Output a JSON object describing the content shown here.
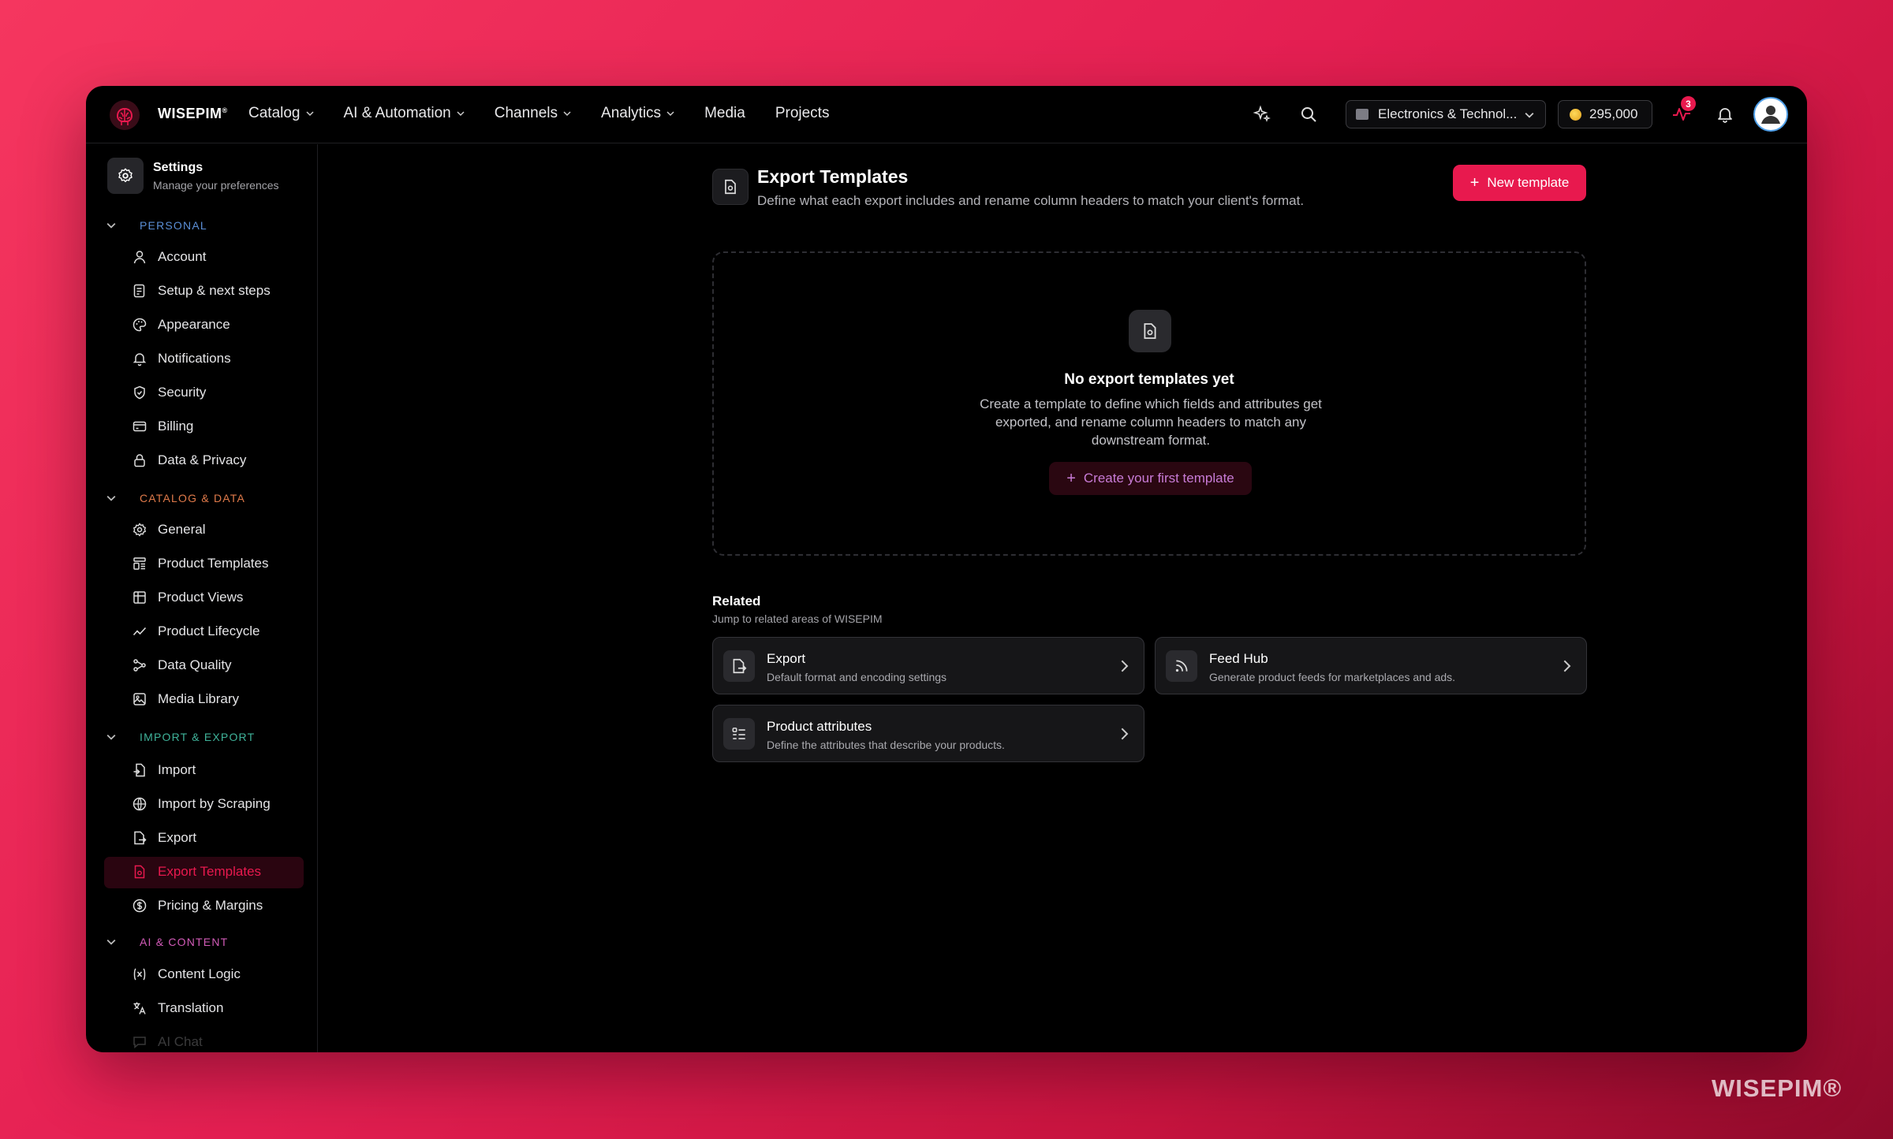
{
  "brand": "WISEPIM",
  "nav": {
    "catalog": "Catalog",
    "ai": "AI & Automation",
    "channels": "Channels",
    "analytics": "Analytics",
    "media": "Media",
    "projects": "Projects"
  },
  "store_select": "Electronics & Technol...",
  "credits": "295,000",
  "activity_badge": "3",
  "sidebar": {
    "title": "Settings",
    "subtitle": "Manage your preferences",
    "sections": {
      "personal": "PERSONAL",
      "catalog": "CATALOG & DATA",
      "import": "IMPORT & EXPORT",
      "ai": "AI & CONTENT"
    },
    "items": {
      "account": "Account",
      "setup": "Setup & next steps",
      "appearance": "Appearance",
      "notifications": "Notifications",
      "security": "Security",
      "billing": "Billing",
      "privacy": "Data & Privacy",
      "general": "General",
      "product_templates": "Product Templates",
      "product_views": "Product Views",
      "product_lifecycle": "Product Lifecycle",
      "data_quality": "Data Quality",
      "media_library": "Media Library",
      "import": "Import",
      "import_scraping": "Import by Scraping",
      "export": "Export",
      "export_templates": "Export Templates",
      "pricing": "Pricing & Margins",
      "content_logic": "Content Logic",
      "translation": "Translation",
      "ai_chat": "AI Chat"
    }
  },
  "page": {
    "title": "Export Templates",
    "subtitle": "Define what each export includes and rename column headers to match your client's format.",
    "new_button": "New template"
  },
  "empty": {
    "title": "No export templates yet",
    "description": "Create a template to define which fields and attributes get exported, and rename column headers to match any downstream format.",
    "button": "Create your first template"
  },
  "related": {
    "title": "Related",
    "subtitle": "Jump to related areas of WISEPIM",
    "cards": [
      {
        "title": "Export",
        "desc": "Default format and encoding settings"
      },
      {
        "title": "Feed Hub",
        "desc": "Generate product feeds for marketplaces and ads."
      },
      {
        "title": "Product attributes",
        "desc": "Define the attributes that describe your products."
      }
    ]
  },
  "watermark": "WISEPIM®",
  "colors": {
    "accent": "#e8194e",
    "section_personal": "#5b8fd6",
    "section_catalog": "#e07a4a",
    "section_import": "#3fb39a",
    "section_ai": "#d25bb8"
  }
}
